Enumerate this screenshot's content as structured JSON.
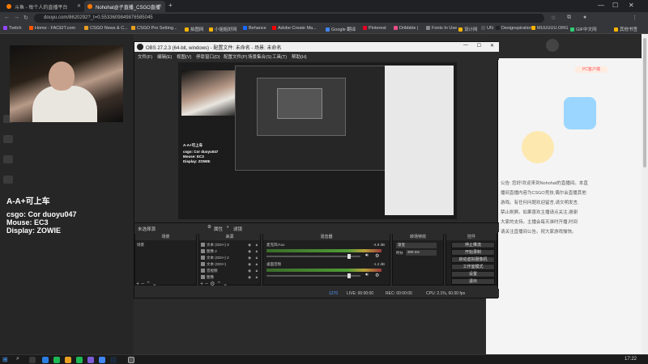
{
  "browser": {
    "tabs": [
      {
        "label": "斗鱼 - 每个人的直播平台"
      },
      {
        "label": "Nohohat@子直播_CSGO直播"
      }
    ],
    "url": "douyu.com/8620292?_t=0.5533609849876585045",
    "bookmarks": [
      "Twitch",
      "Home - FACEIT.com",
      "CSGO News & C...",
      "CSGO Pro Setting...",
      "拍图网",
      "小姐姐好网",
      "Behance",
      "Adobe Create Ma...",
      "Google 翻译",
      "Pinterest",
      "Dribbble |",
      "Fonts In Use",
      "设计网",
      "UN",
      "Designspiration",
      "MUUUUU.ORG",
      "GIF中文网",
      "其他书签"
    ]
  },
  "stream_overlay": {
    "title": "A-A+可上车",
    "line1": "csgo: Cor duoyu047",
    "line2": "Mouse: EC3",
    "line3": "Display: ZOWIE"
  },
  "obs": {
    "title": "OBS 27.2.3 (64-bit, windows) - 配置文件: 未命名 - 场景: 未命名",
    "menu": [
      "文件(F)",
      "编辑(E)",
      "视图(V)",
      "停靠窗口(D)",
      "配置文件(P)",
      "场景集合(S)",
      "工具(T)",
      "帮助(H)"
    ],
    "no_source": "未选择源",
    "prop_btn": "属性",
    "filter_btn": "滤镜",
    "docks": {
      "scenes": {
        "title": "场景",
        "items": [
          "场景"
        ]
      },
      "sources": {
        "title": "来源",
        "items": [
          "文本 (GDI+) 3",
          "图像 2",
          "文本 (GDI+) 2",
          "文本 (GDI+)",
          "音视频",
          "图像"
        ]
      },
      "mixer": {
        "title": "混音器",
        "tracks": [
          {
            "name": "麦克风/Aux",
            "level": "-4.8 dB"
          },
          {
            "name": "桌面音频",
            "level": "-1.2 dB"
          }
        ]
      },
      "transitions": {
        "title": "转场特效",
        "fade": "渐变",
        "duration_label": "时长",
        "duration": "300 ms"
      },
      "controls": {
        "title": "控件",
        "buttons": [
          "停止推流",
          "开始录制",
          "启动虚拟摄像机",
          "工作室模式",
          "设置",
          "退出"
        ]
      }
    },
    "status": {
      "live": "LIVE: 00:00:00",
      "rec": "REC: 00:00:00",
      "cpu": "CPU: 2.1%, 60.00 fps",
      "bitrate": "1270"
    }
  },
  "web_right": {
    "room_label": "PC客户端",
    "text_lines": [
      "公告: 您好!欢迎来到Nohohat的直播间。本直",
      "播间直播内容为CSGO竞技,偶尔会直播其他",
      "游戏。有任何问题欢迎留言,请文明发言,",
      "禁止刷屏。如果喜欢主播请点关注,谢谢",
      "大家的支持。主播会每天准时开播,时间",
      "请关注直播间公告。祝大家游戏愉快。"
    ]
  },
  "taskbar": {
    "time": "17:22"
  }
}
